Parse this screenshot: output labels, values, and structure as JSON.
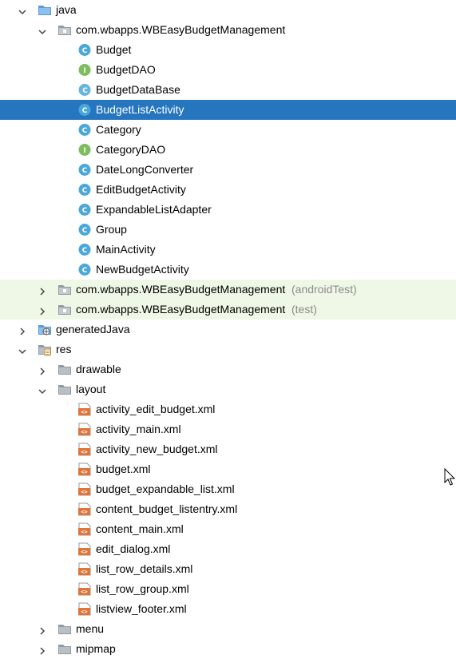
{
  "tree": {
    "nodes": [
      {
        "label": "java",
        "suffix": "",
        "depth": 1,
        "arrow": "down",
        "icon": "folder-blue-icon"
      },
      {
        "label": "com.wbapps.WBEasyBudgetManagement",
        "suffix": "",
        "depth": 2,
        "arrow": "down",
        "icon": "package-folder-icon"
      },
      {
        "label": "Budget",
        "suffix": "",
        "depth": 3,
        "arrow": "none",
        "icon": "class-icon"
      },
      {
        "label": "BudgetDAO",
        "suffix": "",
        "depth": 3,
        "arrow": "none",
        "icon": "interface-icon"
      },
      {
        "label": "BudgetDataBase",
        "suffix": "",
        "depth": 3,
        "arrow": "none",
        "icon": "abstract-class-icon"
      },
      {
        "label": "BudgetListActivity",
        "suffix": "",
        "depth": 3,
        "arrow": "none",
        "icon": "class-icon",
        "state": "selected"
      },
      {
        "label": "Category",
        "suffix": "",
        "depth": 3,
        "arrow": "none",
        "icon": "class-icon"
      },
      {
        "label": "CategoryDAO",
        "suffix": "",
        "depth": 3,
        "arrow": "none",
        "icon": "interface-icon"
      },
      {
        "label": "DateLongConverter",
        "suffix": "",
        "depth": 3,
        "arrow": "none",
        "icon": "class-icon"
      },
      {
        "label": "EditBudgetActivity",
        "suffix": "",
        "depth": 3,
        "arrow": "none",
        "icon": "class-icon"
      },
      {
        "label": "ExpandableListAdapter",
        "suffix": "",
        "depth": 3,
        "arrow": "none",
        "icon": "class-icon"
      },
      {
        "label": "Group",
        "suffix": "",
        "depth": 3,
        "arrow": "none",
        "icon": "class-icon"
      },
      {
        "label": "MainActivity",
        "suffix": "",
        "depth": 3,
        "arrow": "none",
        "icon": "class-icon"
      },
      {
        "label": "NewBudgetActivity",
        "suffix": "",
        "depth": 3,
        "arrow": "none",
        "icon": "class-icon"
      },
      {
        "label": "com.wbapps.WBEasyBudgetManagement",
        "suffix": "(androidTest)",
        "depth": 2,
        "arrow": "right",
        "icon": "package-folder-icon",
        "state": "tinted"
      },
      {
        "label": "com.wbapps.WBEasyBudgetManagement",
        "suffix": "(test)",
        "depth": 2,
        "arrow": "right",
        "icon": "package-folder-icon",
        "state": "tinted"
      },
      {
        "label": "generatedJava",
        "suffix": "",
        "depth": 1,
        "arrow": "right",
        "icon": "generated-folder-icon"
      },
      {
        "label": "res",
        "suffix": "",
        "depth": 1,
        "arrow": "down",
        "icon": "resource-folder-icon"
      },
      {
        "label": "drawable",
        "suffix": "",
        "depth": 2,
        "arrow": "right",
        "icon": "folder-icon"
      },
      {
        "label": "layout",
        "suffix": "",
        "depth": 2,
        "arrow": "down",
        "icon": "folder-icon"
      },
      {
        "label": "activity_edit_budget.xml",
        "suffix": "",
        "depth": 3,
        "arrow": "none",
        "icon": "xml-file-icon"
      },
      {
        "label": "activity_main.xml",
        "suffix": "",
        "depth": 3,
        "arrow": "none",
        "icon": "xml-file-icon"
      },
      {
        "label": "activity_new_budget.xml",
        "suffix": "",
        "depth": 3,
        "arrow": "none",
        "icon": "xml-file-icon"
      },
      {
        "label": "budget.xml",
        "suffix": "",
        "depth": 3,
        "arrow": "none",
        "icon": "xml-file-icon"
      },
      {
        "label": "budget_expandable_list.xml",
        "suffix": "",
        "depth": 3,
        "arrow": "none",
        "icon": "xml-file-icon"
      },
      {
        "label": "content_budget_listentry.xml",
        "suffix": "",
        "depth": 3,
        "arrow": "none",
        "icon": "xml-file-icon"
      },
      {
        "label": "content_main.xml",
        "suffix": "",
        "depth": 3,
        "arrow": "none",
        "icon": "xml-file-icon"
      },
      {
        "label": "edit_dialog.xml",
        "suffix": "",
        "depth": 3,
        "arrow": "none",
        "icon": "xml-file-icon"
      },
      {
        "label": "list_row_details.xml",
        "suffix": "",
        "depth": 3,
        "arrow": "none",
        "icon": "xml-file-icon"
      },
      {
        "label": "list_row_group.xml",
        "suffix": "",
        "depth": 3,
        "arrow": "none",
        "icon": "xml-file-icon"
      },
      {
        "label": "listview_footer.xml",
        "suffix": "",
        "depth": 3,
        "arrow": "none",
        "icon": "xml-file-icon"
      },
      {
        "label": "menu",
        "suffix": "",
        "depth": 2,
        "arrow": "right",
        "icon": "folder-icon"
      },
      {
        "label": "mipmap",
        "suffix": "",
        "depth": 2,
        "arrow": "right",
        "icon": "folder-icon"
      }
    ]
  },
  "colors": {
    "selection": "#2675bf",
    "tinted_row": "#eff7e6",
    "class_icon": "#4aa8d8",
    "interface_icon": "#7dbd5c",
    "folder": "#8f9aa3",
    "folder_blue": "#5a9ad8",
    "xml_icon": "#e0753b",
    "suffix_text": "#8c8c8c"
  },
  "cursor": {
    "icon": "mouse-pointer-icon"
  }
}
